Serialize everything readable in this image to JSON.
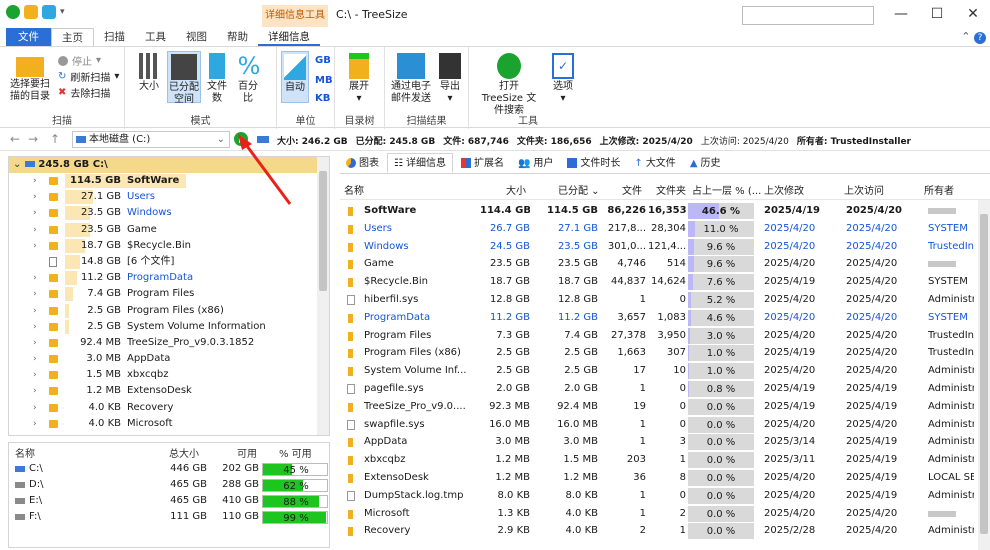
{
  "window": {
    "context_tab": "详细信息工具",
    "title": "C:\\ - TreeSize",
    "min": "—",
    "max": "☐",
    "close": "✕"
  },
  "ribbon_tabs": {
    "file": "文件",
    "home": "主页",
    "scan": "扫描",
    "tools": "工具",
    "view": "视图",
    "help": "帮助",
    "details": "详细信息"
  },
  "ribbon": {
    "select_dir": "选择要扫描的目录",
    "stop": "停止",
    "refresh": "刷新扫描",
    "remove": "去除扫描",
    "group_scan": "扫描",
    "large": "大小",
    "allocated": "已分配空间",
    "files": "文件数",
    "percent": "百分比",
    "group_mode": "模式",
    "auto": "自动",
    "gb": "GB",
    "mb": "MB",
    "kb": "KB",
    "group_unit": "单位",
    "expand": "展开",
    "group_tree": "目录树",
    "email": "通过电子邮件发送",
    "export": "导出",
    "group_results": "扫描结果",
    "open_search": "打开 TreeSize 文件搜索",
    "options": "选项",
    "group_tools": "工具"
  },
  "address": {
    "path": "本地磁盘 (C:)",
    "size": "大小: 246.2 GB",
    "allocated": "已分配: 245.8 GB",
    "files": "文件: 687,746",
    "folders": "文件夹: 186,656",
    "last_modified": "上次修改: 2025/4/20",
    "last_accessed": "上次访问: 2025/4/20",
    "owner": "所有者: TrustedInstaller"
  },
  "tree": {
    "root": "245.8 GB  C:\\",
    "items": [
      {
        "size": "114.5 GB",
        "name": "SoftWare",
        "bar": 0.47,
        "bold": true,
        "blue": false,
        "exp": true,
        "type": "folder"
      },
      {
        "size": "27.1 GB",
        "name": "Users",
        "bar": 0.11,
        "bold": false,
        "blue": true,
        "exp": true,
        "type": "folder"
      },
      {
        "size": "23.5 GB",
        "name": "Windows",
        "bar": 0.096,
        "bold": false,
        "blue": true,
        "exp": true,
        "type": "folder"
      },
      {
        "size": "23.5 GB",
        "name": "Game",
        "bar": 0.096,
        "bold": false,
        "blue": false,
        "exp": true,
        "type": "folder"
      },
      {
        "size": "18.7 GB",
        "name": "$Recycle.Bin",
        "bar": 0.076,
        "bold": false,
        "blue": false,
        "exp": true,
        "type": "folder"
      },
      {
        "size": "14.8 GB",
        "name": "[6 个文件]",
        "bar": 0.06,
        "bold": false,
        "blue": false,
        "exp": false,
        "type": "file"
      },
      {
        "size": "11.2 GB",
        "name": "ProgramData",
        "bar": 0.046,
        "bold": false,
        "blue": true,
        "exp": true,
        "type": "folder"
      },
      {
        "size": "7.4 GB",
        "name": "Program Files",
        "bar": 0.03,
        "bold": false,
        "blue": false,
        "exp": true,
        "type": "folder"
      },
      {
        "size": "2.5 GB",
        "name": "Program Files (x86)",
        "bar": 0.01,
        "bold": false,
        "blue": false,
        "exp": true,
        "type": "folder"
      },
      {
        "size": "2.5 GB",
        "name": "System Volume Information",
        "bar": 0.01,
        "bold": false,
        "blue": false,
        "exp": true,
        "type": "folder"
      },
      {
        "size": "92.4 MB",
        "name": "TreeSize_Pro_v9.0.3.1852",
        "bar": 0,
        "bold": false,
        "blue": false,
        "exp": true,
        "type": "folder"
      },
      {
        "size": "3.0 MB",
        "name": "AppData",
        "bar": 0,
        "bold": false,
        "blue": false,
        "exp": true,
        "type": "folder"
      },
      {
        "size": "1.5 MB",
        "name": "xbxcqbz",
        "bar": 0,
        "bold": false,
        "blue": false,
        "exp": true,
        "type": "folder"
      },
      {
        "size": "1.2 MB",
        "name": "ExtensoDesk",
        "bar": 0,
        "bold": false,
        "blue": false,
        "exp": true,
        "type": "folder"
      },
      {
        "size": "4.0 KB",
        "name": "Recovery",
        "bar": 0,
        "bold": false,
        "blue": false,
        "exp": true,
        "type": "folder"
      },
      {
        "size": "4.0 KB",
        "name": "Microsoft",
        "bar": 0,
        "bold": false,
        "blue": false,
        "exp": true,
        "type": "folder"
      }
    ]
  },
  "drives": {
    "headers": {
      "name": "名称",
      "total": "总大小",
      "free": "可用",
      "pct": "% 可用"
    },
    "rows": [
      {
        "name": "C:\\",
        "total": "446 GB",
        "free": "202 GB",
        "pct": "45 %",
        "level": 0.45
      },
      {
        "name": "D:\\",
        "total": "465 GB",
        "free": "288 GB",
        "pct": "62 %",
        "level": 0.62
      },
      {
        "name": "E:\\",
        "total": "465 GB",
        "free": "410 GB",
        "pct": "88 %",
        "level": 0.88
      },
      {
        "name": "F:\\",
        "total": "111 GB",
        "free": "110 GB",
        "pct": "99 %",
        "level": 0.99
      }
    ]
  },
  "view_tabs": {
    "chart": "图表",
    "details": "详细信息",
    "ext": "扩展名",
    "users": "用户",
    "age": "文件时长",
    "top": "大文件",
    "history": "历史"
  },
  "grid": {
    "headers": {
      "name": "名称",
      "size": "大小",
      "alloc": "已分配",
      "files": "文件",
      "folders": "文件夹",
      "pct": "占上一层 % (...",
      "mod": "上次修改",
      "acc": "上次访问",
      "owner": "所有者"
    },
    "rows": [
      {
        "name": "SoftWare",
        "size": "114.4 GB",
        "alloc": "114.5 GB",
        "files": "86,226",
        "folders": "16,353",
        "pct": "46.6 %",
        "level": 0.466,
        "mod": "2025/4/19",
        "acc": "2025/4/20",
        "owner": "",
        "type": "folder",
        "bold": true,
        "blue": false
      },
      {
        "name": "Users",
        "size": "26.7 GB",
        "alloc": "27.1 GB",
        "files": "217,8...",
        "folders": "28,304",
        "pct": "11.0 %",
        "level": 0.11,
        "mod": "2025/4/20",
        "acc": "2025/4/20",
        "owner": "SYSTEM",
        "type": "folder",
        "bold": false,
        "blue": true
      },
      {
        "name": "Windows",
        "size": "24.5 GB",
        "alloc": "23.5 GB",
        "files": "301,0...",
        "folders": "121,4...",
        "pct": "9.6 %",
        "level": 0.096,
        "mod": "2025/4/20",
        "acc": "2025/4/20",
        "owner": "TrustedIns",
        "type": "folder",
        "bold": false,
        "blue": true
      },
      {
        "name": "Game",
        "size": "23.5 GB",
        "alloc": "23.5 GB",
        "files": "4,746",
        "folders": "514",
        "pct": "9.6 %",
        "level": 0.096,
        "mod": "2025/4/20",
        "acc": "2025/4/20",
        "owner": "",
        "type": "folder",
        "bold": false,
        "blue": false
      },
      {
        "name": "$Recycle.Bin",
        "size": "18.7 GB",
        "alloc": "18.7 GB",
        "files": "44,837",
        "folders": "14,624",
        "pct": "7.6 %",
        "level": 0.076,
        "mod": "2025/4/19",
        "acc": "2025/4/20",
        "owner": "SYSTEM",
        "type": "folder",
        "bold": false,
        "blue": false
      },
      {
        "name": "hiberfil.sys",
        "size": "12.8 GB",
        "alloc": "12.8 GB",
        "files": "1",
        "folders": "0",
        "pct": "5.2 %",
        "level": 0.052,
        "mod": "2025/4/20",
        "acc": "2025/4/20",
        "owner": "Administr",
        "type": "file",
        "bold": false,
        "blue": false
      },
      {
        "name": "ProgramData",
        "size": "11.2 GB",
        "alloc": "11.2 GB",
        "files": "3,657",
        "folders": "1,083",
        "pct": "4.6 %",
        "level": 0.046,
        "mod": "2025/4/20",
        "acc": "2025/4/20",
        "owner": "SYSTEM",
        "type": "folder",
        "bold": false,
        "blue": true
      },
      {
        "name": "Program Files",
        "size": "7.3 GB",
        "alloc": "7.4 GB",
        "files": "27,378",
        "folders": "3,950",
        "pct": "3.0 %",
        "level": 0.03,
        "mod": "2025/4/20",
        "acc": "2025/4/20",
        "owner": "TrustedIns",
        "type": "folder",
        "bold": false,
        "blue": false
      },
      {
        "name": "Program Files (x86)",
        "size": "2.5 GB",
        "alloc": "2.5 GB",
        "files": "1,663",
        "folders": "307",
        "pct": "1.0 %",
        "level": 0.01,
        "mod": "2025/4/19",
        "acc": "2025/4/20",
        "owner": "TrustedIns",
        "type": "folder",
        "bold": false,
        "blue": false
      },
      {
        "name": "System Volume Inf...",
        "size": "2.5 GB",
        "alloc": "2.5 GB",
        "files": "17",
        "folders": "10",
        "pct": "1.0 %",
        "level": 0.01,
        "mod": "2025/4/20",
        "acc": "2025/4/20",
        "owner": "Administr",
        "type": "folder",
        "bold": false,
        "blue": false
      },
      {
        "name": "pagefile.sys",
        "size": "2.0 GB",
        "alloc": "2.0 GB",
        "files": "1",
        "folders": "0",
        "pct": "0.8 %",
        "level": 0.008,
        "mod": "2025/4/19",
        "acc": "2025/4/19",
        "owner": "Administr",
        "type": "file",
        "bold": false,
        "blue": false
      },
      {
        "name": "TreeSize_Pro_v9.0....",
        "size": "92.3 MB",
        "alloc": "92.4 MB",
        "files": "19",
        "folders": "0",
        "pct": "0.0 %",
        "level": 0,
        "mod": "2025/4/19",
        "acc": "2025/4/19",
        "owner": "Administr",
        "type": "folder",
        "bold": false,
        "blue": false
      },
      {
        "name": "swapfile.sys",
        "size": "16.0 MB",
        "alloc": "16.0 MB",
        "files": "1",
        "folders": "0",
        "pct": "0.0 %",
        "level": 0,
        "mod": "2025/4/20",
        "acc": "2025/4/20",
        "owner": "Administr",
        "type": "file",
        "bold": false,
        "blue": false
      },
      {
        "name": "AppData",
        "size": "3.0 MB",
        "alloc": "3.0 MB",
        "files": "1",
        "folders": "3",
        "pct": "0.0 %",
        "level": 0,
        "mod": "2025/3/14",
        "acc": "2025/4/19",
        "owner": "Administr",
        "type": "folder",
        "bold": false,
        "blue": false
      },
      {
        "name": "xbxcqbz",
        "size": "1.2 MB",
        "alloc": "1.5 MB",
        "files": "203",
        "folders": "1",
        "pct": "0.0 %",
        "level": 0,
        "mod": "2025/3/11",
        "acc": "2025/4/19",
        "owner": "Administr",
        "type": "folder",
        "bold": false,
        "blue": false
      },
      {
        "name": "ExtensoDesk",
        "size": "1.2 MB",
        "alloc": "1.2 MB",
        "files": "36",
        "folders": "8",
        "pct": "0.0 %",
        "level": 0,
        "mod": "2025/4/20",
        "acc": "2025/4/19",
        "owner": "LOCAL SEI",
        "type": "folder",
        "bold": false,
        "blue": false
      },
      {
        "name": "DumpStack.log.tmp",
        "size": "8.0 KB",
        "alloc": "8.0 KB",
        "files": "1",
        "folders": "0",
        "pct": "0.0 %",
        "level": 0,
        "mod": "2025/4/20",
        "acc": "2025/4/19",
        "owner": "Administr",
        "type": "tmp",
        "bold": false,
        "blue": false
      },
      {
        "name": "Microsoft",
        "size": "1.3 KB",
        "alloc": "4.0 KB",
        "files": "1",
        "folders": "2",
        "pct": "0.0 %",
        "level": 0,
        "mod": "2025/4/20",
        "acc": "2025/4/20",
        "owner": "",
        "type": "folder",
        "bold": false,
        "blue": false
      },
      {
        "name": "Recovery",
        "size": "2.9 KB",
        "alloc": "4.0 KB",
        "files": "2",
        "folders": "1",
        "pct": "0.0 %",
        "level": 0,
        "mod": "2025/2/28",
        "acc": "2025/4/20",
        "owner": "Administr",
        "type": "folder",
        "bold": false,
        "blue": false
      }
    ]
  }
}
